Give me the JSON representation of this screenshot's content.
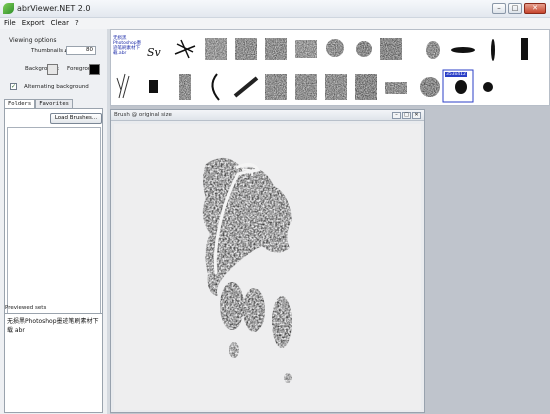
{
  "window": {
    "title": "abrViewer.NET 2.0",
    "btn_min": "–",
    "btn_max": "□",
    "btn_close": "✕"
  },
  "menu": [
    "File",
    "Export",
    "Clear",
    "?"
  ],
  "options": {
    "section": "Viewing options",
    "thumb_label": "Thumbnails size:",
    "thumb_value": "80",
    "background_label": "Background:",
    "background_color": "#e6e6e6",
    "foreground_label": "Foreground:",
    "foreground_color": "#000000",
    "alternating_label": "Alternating background",
    "alternating_checked": true
  },
  "tabs": [
    "Folders",
    "Favorites"
  ],
  "load_button": "Load Brushes...",
  "preview": {
    "label": "Previewed sets",
    "text": "无损黑Photoshop墨迹笔刷素材下载 abr"
  },
  "thumbnails": {
    "first_caption": "无损黑Photoshop墨迹笔刷素材下载.abr",
    "selected_tag": "353x412"
  },
  "brush_window": {
    "title": "Brush @ original size"
  },
  "icons": {
    "app": "leaf-icon",
    "minimize": "minimize-icon",
    "maximize": "maximize-icon",
    "close": "close-icon"
  }
}
